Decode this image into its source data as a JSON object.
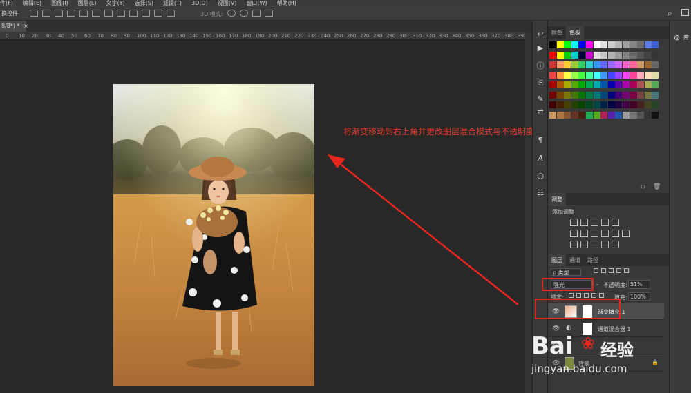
{
  "menubar": {
    "items": [
      "件(F)",
      "编辑(E)",
      "图像(I)",
      "图层(L)",
      "文字(Y)",
      "选择(S)",
      "滤镜(T)",
      "3D(D)",
      "视图(V)",
      "窗口(W)",
      "帮助(H)"
    ]
  },
  "optbar": {
    "transform_label": "换控件",
    "mode_label": "3D 模式:"
  },
  "document": {
    "tab_label": "8/8*) *",
    "close_glyph": "×"
  },
  "ruler": {
    "ticks": [
      "0",
      "10",
      "20",
      "30",
      "40",
      "50",
      "60",
      "70",
      "80",
      "90",
      "100",
      "110",
      "120",
      "130",
      "140",
      "150",
      "160",
      "170",
      "180",
      "190",
      "200",
      "210",
      "220",
      "230",
      "240",
      "250",
      "260",
      "270",
      "280",
      "290",
      "300",
      "310",
      "320",
      "330",
      "340",
      "350",
      "360",
      "370",
      "380",
      "390",
      "400"
    ]
  },
  "annotation": {
    "text": "将渐变移动到右上角并更改图层混合模式与不透明度",
    "color": "#e83a2e"
  },
  "colors_panel": {
    "tabs": [
      "颜色",
      "色板"
    ],
    "active_tab": "色板"
  },
  "adjust_panel": {
    "tab": "调整",
    "subtitle": "添加调整"
  },
  "layers_panel": {
    "tabs": [
      "图层",
      "通道",
      "路径"
    ],
    "filter_label": "ρ 类型",
    "blend_mode": "强光",
    "opacity_label": "不透明度:",
    "opacity_value": "51%",
    "lock_label": "锁定:",
    "fill_label": "填充:",
    "fill_value": "100%",
    "layers": [
      {
        "name": "渐变填充 1"
      },
      {
        "name": "通道混合器 1"
      },
      {
        "name": ""
      },
      {
        "name": "背景"
      }
    ]
  },
  "right_panel": {
    "label": "库"
  },
  "watermark": {
    "brand_text": "Bai",
    "jingyan_text": "经验",
    "url": "jingyan.baidu.com"
  },
  "accent": {
    "highlight": "#e8261d"
  }
}
